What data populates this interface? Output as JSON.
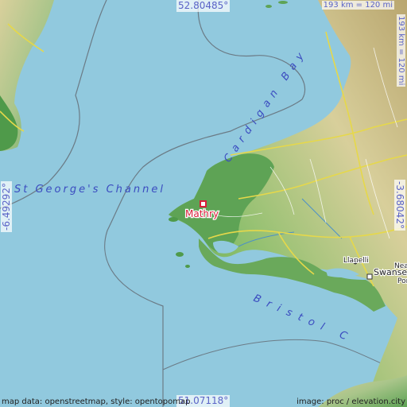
{
  "place": {
    "name": "Mathry",
    "marker_color": "#d81f3a"
  },
  "labels": {
    "channel": "St George's Channel",
    "cardigan_bay": "Cardigan Bay",
    "bristol_channel": "Bristol C",
    "llanelli": "Llanelli",
    "swansea": "Swanse",
    "neath": "Nea",
    "port": "Por"
  },
  "coords": {
    "top": "52.80485°",
    "bottom": "51.07118°",
    "left": "-6.49292°",
    "right": "-3.68042°"
  },
  "scale": {
    "horizontal": "193 km = 120 mi",
    "vertical": "193 km = 120 mi"
  },
  "attribution": {
    "left": "map data: openstreetmap, style: opentopomap",
    "right": "image: proc / elevation.city"
  },
  "colors": {
    "sea": "#91c9de",
    "lowland": "#5fa253",
    "upland": "#d9cf9a",
    "highland": "#b3a36b",
    "road": "#e6d84a",
    "text_blue": "#5a63c7",
    "place_red": "#d81f3a"
  }
}
